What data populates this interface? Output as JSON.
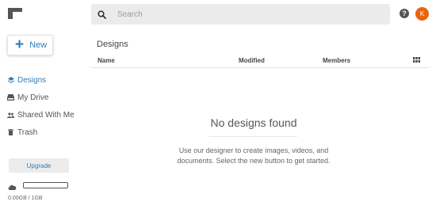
{
  "app": {
    "logo_icon": "app-logo-icon"
  },
  "sidebar": {
    "new_button": {
      "label": "New",
      "icon": "plus-icon"
    },
    "items": [
      {
        "label": "Designs",
        "icon": "layers-icon",
        "active": true
      },
      {
        "label": "My Drive",
        "icon": "drive-icon",
        "active": false
      },
      {
        "label": "Shared With Me",
        "icon": "people-icon",
        "active": false
      },
      {
        "label": "Trash",
        "icon": "trash-icon",
        "active": false
      }
    ],
    "upgrade_label": "Upgrade",
    "storage": {
      "text": "0.00GB / 1GB",
      "used_fraction": 0.0,
      "icon": "cloud-icon"
    }
  },
  "header": {
    "search": {
      "placeholder": "Search",
      "value": "",
      "icon": "search-icon"
    },
    "help_label": "?",
    "avatar_initial": "K"
  },
  "main": {
    "title": "Designs",
    "columns": {
      "name": "Name",
      "modified": "Modified",
      "members": "Members"
    },
    "empty": {
      "title": "No designs found",
      "description": "Use our designer to create images, videos, and documents. Select the new button to get started."
    }
  },
  "colors": {
    "accent": "#2e7db8",
    "avatar": "#e8650f",
    "search_bg": "#ebebeb"
  }
}
